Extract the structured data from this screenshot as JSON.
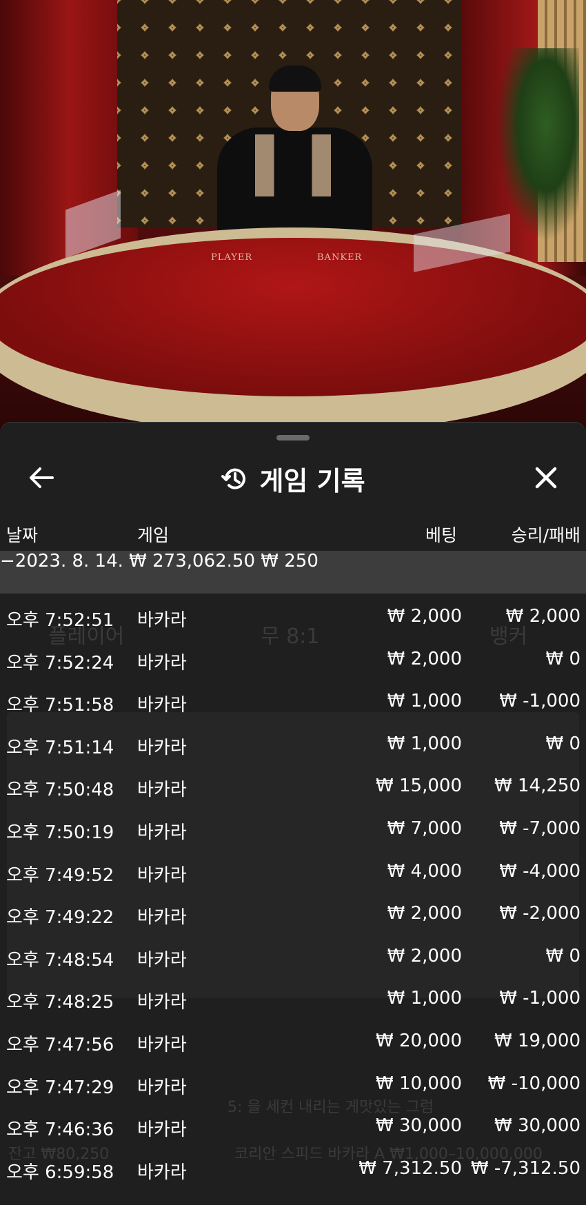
{
  "video": {
    "table_labels": [
      "PLAYER",
      "BANKER"
    ]
  },
  "sheet": {
    "title": "게임 기록",
    "columns": {
      "date": "날짜",
      "game": "게임",
      "bet": "베팅",
      "winloss": "승리/패배"
    },
    "day_summary": {
      "date": "−2023. 8. 14.",
      "bet": "₩ 273,062.50",
      "winloss": "₩ 250"
    },
    "rows": [
      {
        "time": "오후 7:52:51",
        "game": "바카라",
        "bet": "₩ 2,000",
        "winloss": "₩ 2,000"
      },
      {
        "time": "오후 7:52:24",
        "game": "바카라",
        "bet": "₩ 2,000",
        "winloss": "₩ 0"
      },
      {
        "time": "오후 7:51:58",
        "game": "바카라",
        "bet": "₩ 1,000",
        "winloss": "₩ -1,000"
      },
      {
        "time": "오후 7:51:14",
        "game": "바카라",
        "bet": "₩ 1,000",
        "winloss": "₩ 0"
      },
      {
        "time": "오후 7:50:48",
        "game": "바카라",
        "bet": "₩ 15,000",
        "winloss": "₩ 14,250"
      },
      {
        "time": "오후 7:50:19",
        "game": "바카라",
        "bet": "₩ 7,000",
        "winloss": "₩ -7,000"
      },
      {
        "time": "오후 7:49:52",
        "game": "바카라",
        "bet": "₩ 4,000",
        "winloss": "₩ -4,000"
      },
      {
        "time": "오후 7:49:22",
        "game": "바카라",
        "bet": "₩ 2,000",
        "winloss": "₩ -2,000"
      },
      {
        "time": "오후 7:48:54",
        "game": "바카라",
        "bet": "₩ 2,000",
        "winloss": "₩ 0"
      },
      {
        "time": "오후 7:48:25",
        "game": "바카라",
        "bet": "₩ 1,000",
        "winloss": "₩ -1,000"
      },
      {
        "time": "오후 7:47:56",
        "game": "바카라",
        "bet": "₩ 20,000",
        "winloss": "₩ 19,000"
      },
      {
        "time": "오후 7:47:29",
        "game": "바카라",
        "bet": "₩ 10,000",
        "winloss": "₩ -10,000"
      },
      {
        "time": "오후 7:46:36",
        "game": "바카라",
        "bet": "₩ 30,000",
        "winloss": "₩ 30,000"
      },
      {
        "time": "오후 6:59:58",
        "game": "바카라",
        "bet": "₩ 7,312.50",
        "winloss": "₩ -7,312.50"
      }
    ]
  },
  "background_ui": {
    "player_label": "플레이어",
    "tie_label": "무 8:1",
    "banker_label": "뱅커",
    "chat_line": "5: 을 세컨 내리는 게맛있는 그럼",
    "balance": "잔고 ₩80,250",
    "table_info": "코리안 스피드 바카라 A ₩1,000–10,000,000"
  },
  "icons": {
    "back": "arrow-left-icon",
    "history": "history-icon",
    "close": "close-icon"
  },
  "colors": {
    "sheet_bg": "#1f1f1f",
    "summary_bg": "#3d3d3d",
    "text": "#ffffff"
  }
}
